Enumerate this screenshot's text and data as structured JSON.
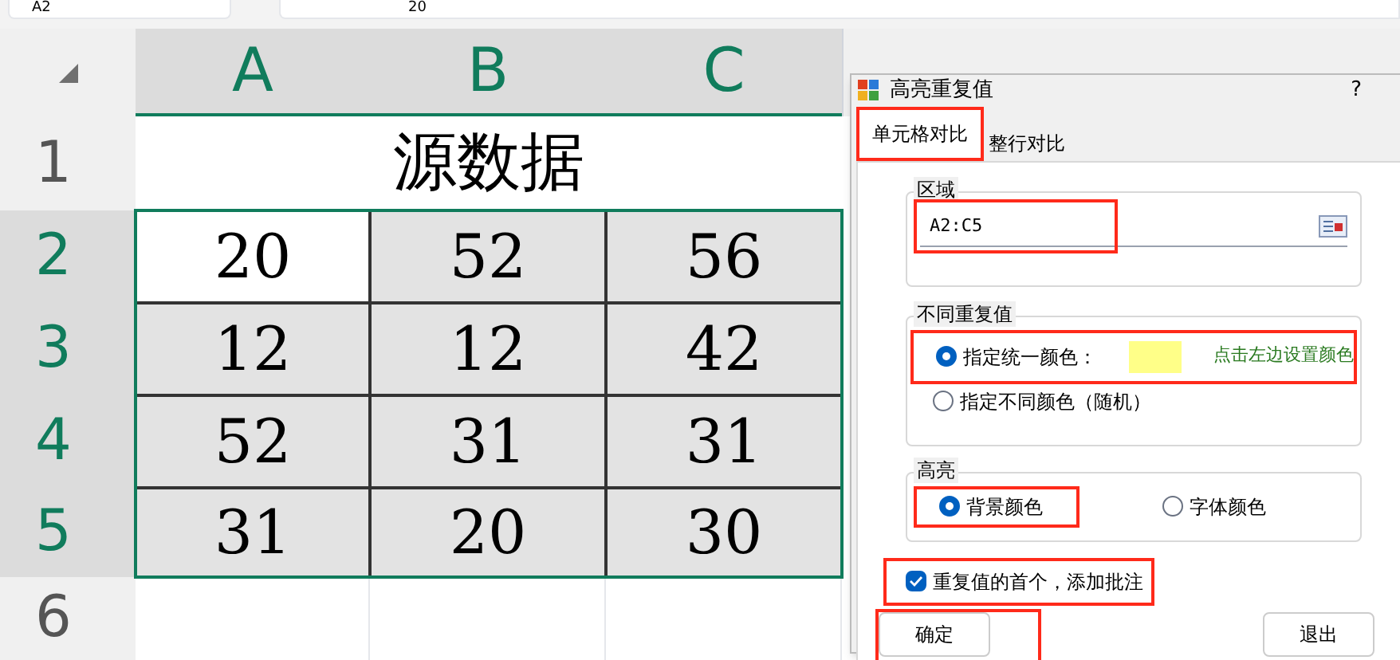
{
  "formula_bar": {
    "name_box": "A2",
    "value": "20"
  },
  "sheet": {
    "columns": [
      {
        "label": "A",
        "selected": true
      },
      {
        "label": "B",
        "selected": true
      },
      {
        "label": "C",
        "selected": true
      }
    ],
    "rows": [
      {
        "label": "1",
        "selected": false,
        "title": "源数据"
      },
      {
        "label": "2",
        "selected": true,
        "cells": [
          {
            "value": "20",
            "highlighted": false
          },
          {
            "value": "52",
            "highlighted": true
          },
          {
            "value": "56",
            "highlighted": true
          }
        ]
      },
      {
        "label": "3",
        "selected": true,
        "cells": [
          {
            "value": "12",
            "highlighted": true
          },
          {
            "value": "12",
            "highlighted": true
          },
          {
            "value": "42",
            "highlighted": true
          }
        ]
      },
      {
        "label": "4",
        "selected": true,
        "cells": [
          {
            "value": "52",
            "highlighted": true
          },
          {
            "value": "31",
            "highlighted": true
          },
          {
            "value": "31",
            "highlighted": true
          }
        ]
      },
      {
        "label": "5",
        "selected": true,
        "cells": [
          {
            "value": "31",
            "highlighted": true
          },
          {
            "value": "20",
            "highlighted": true
          },
          {
            "value": "30",
            "highlighted": true
          }
        ]
      },
      {
        "label": "6",
        "selected": false,
        "cells": []
      }
    ]
  },
  "dialog": {
    "title": "高亮重复值",
    "help": "?",
    "tabs": [
      {
        "label": "单元格对比",
        "selected": true,
        "marked": true
      },
      {
        "label": "整行对比",
        "selected": false,
        "marked": false
      }
    ],
    "range_group": {
      "title": "区域",
      "value": "A2:C5",
      "marked": true
    },
    "duplicate_group": {
      "title": "不同重复值",
      "options": [
        {
          "label": "指定统一颜色：",
          "selected": true,
          "marked": true,
          "color": "#ffff88",
          "hint": "点击左边设置颜色"
        },
        {
          "label": "指定不同颜色（随机）",
          "selected": false,
          "marked": false
        }
      ]
    },
    "highlight_group": {
      "title": "高亮",
      "options": [
        {
          "label": "背景颜色",
          "selected": true,
          "marked": true
        },
        {
          "label": "字体颜色",
          "selected": false,
          "marked": false
        }
      ]
    },
    "comment_checkbox": {
      "label": "重复值的首个，添加批注",
      "checked": true,
      "marked": true
    },
    "buttons": [
      {
        "label": "确定",
        "marked": true
      },
      {
        "label": "退出",
        "marked": false
      }
    ]
  }
}
